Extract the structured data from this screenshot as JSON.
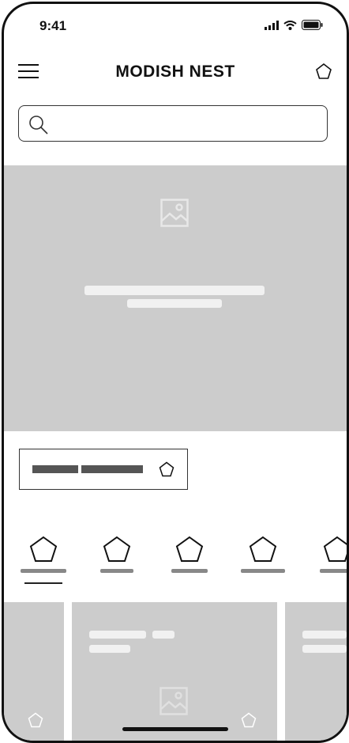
{
  "status_bar": {
    "time": "9:41",
    "icons": [
      "signal-icon",
      "wifi-icon",
      "battery-icon"
    ]
  },
  "header": {
    "title": "MODISH NEST",
    "menu_icon": "hamburger-icon",
    "bag_icon": "pentagon-icon"
  },
  "search": {
    "value": "",
    "placeholder": "",
    "icon": "search-icon"
  },
  "hero": {
    "icon": "image-placeholder-icon"
  },
  "promo_chip": {
    "icon": "pentagon-icon"
  },
  "categories": {
    "count_visible": 5,
    "selected_index": 0
  },
  "product_cards": {
    "icons": [
      "pentagon-icon",
      "image-placeholder-icon"
    ]
  },
  "colors": {
    "placeholder_gray": "#cccccc",
    "text_dark": "#111111",
    "bar_dark": "#555555",
    "bar_light": "#f1f1f1"
  }
}
